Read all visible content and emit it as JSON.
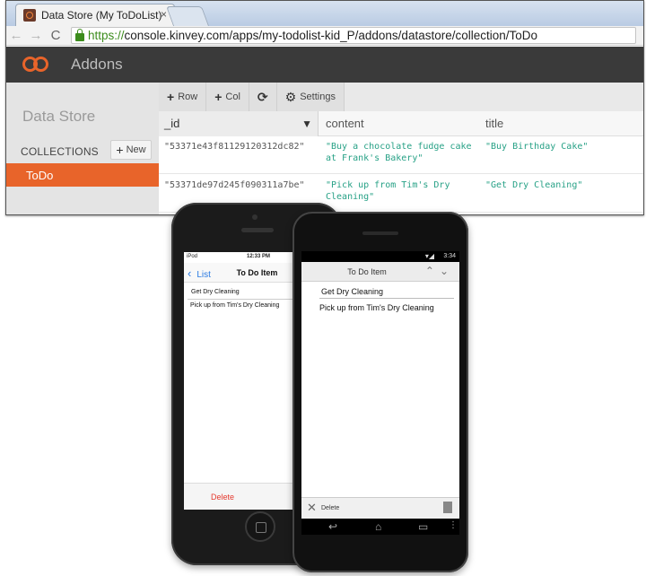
{
  "browser": {
    "tab_title": "Data Store (My ToDoList)",
    "tab_close": "×",
    "back_glyph": "←",
    "forward_glyph": "→",
    "reload_glyph": "C",
    "url_scheme": "https://",
    "url_rest": "console.kinvey.com/apps/my-todolist-kid_P/addons/datastore/collection/ToDo"
  },
  "app": {
    "title": "Addons",
    "accent": "#e8642a"
  },
  "sidebar": {
    "title": "Data Store",
    "collections_label": "COLLECTIONS",
    "new_label": "New",
    "items": [
      {
        "label": "ToDo"
      }
    ]
  },
  "toolbar": {
    "row_label": "Row",
    "col_label": "Col",
    "settings_label": "Settings"
  },
  "table": {
    "columns": [
      "_id",
      "content",
      "title"
    ],
    "sort_glyph": "▼",
    "rows": [
      {
        "id": "\"53371e43f81129120312dc82\"",
        "content_line1": "\"Buy a chocolate fudge cake",
        "content_line2": "at Frank's Bakery\"",
        "title": "\"Buy Birthday Cake\""
      },
      {
        "id": "\"53371de97d245f090311a7be\"",
        "content_line1": "\"Pick up from Tim's Dry",
        "content_line2": "Cleaning\"",
        "title": "\"Get Dry Cleaning\""
      }
    ]
  },
  "iphone": {
    "carrier": "iPod",
    "time": "12:33 PM",
    "back_label": "List",
    "title": "To Do Item",
    "field_title": "Get Dry Cleaning",
    "field_content": "Pick up from Tim's Dry Cleaning",
    "delete_label": "Delete"
  },
  "android": {
    "time": "3:34",
    "title": "To Do Item",
    "field_title": "Get Dry Cleaning",
    "field_content": "Pick up from Tim's Dry Cleaning",
    "delete_label": "Delete"
  }
}
